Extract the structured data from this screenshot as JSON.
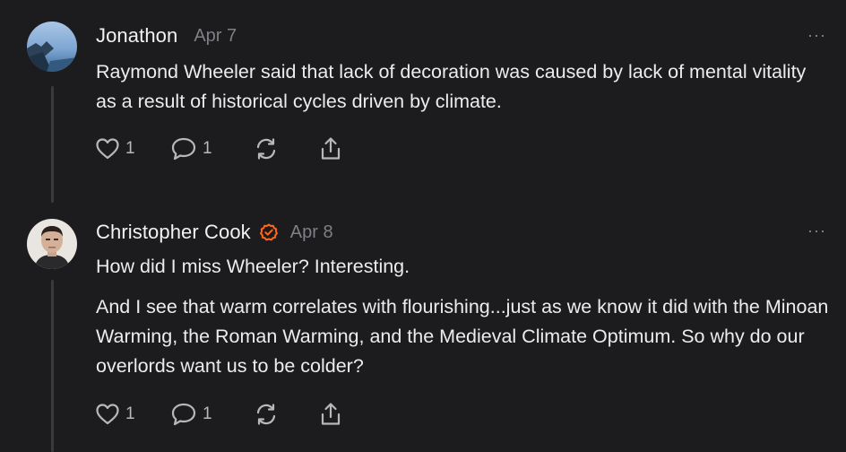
{
  "comments": [
    {
      "author": "Jonathon",
      "date": "Apr 7",
      "verified": false,
      "paragraphs": [
        "Raymond Wheeler said that lack of decoration was caused by lack of mental vitality as a result of historical cycles driven by climate."
      ],
      "likes": "1",
      "replies": "1",
      "more": "···"
    },
    {
      "author": "Christopher Cook",
      "date": "Apr 8",
      "verified": true,
      "paragraphs": [
        "How did I miss Wheeler? Interesting.",
        "And I see that warm correlates with flourishing...just as we know it did with the Minoan Warming, the Roman Warming, and the Medieval Climate Optimum. So why do our overlords want us to be colder?"
      ],
      "likes": "1",
      "replies": "1",
      "more": "···"
    }
  ],
  "colors": {
    "background": "#1c1c1e",
    "verified_badge": "#ff6719",
    "muted_text": "#7f7f84"
  },
  "icons": [
    "heart-icon",
    "comment-icon",
    "restack-icon",
    "share-icon",
    "more-icon",
    "verified-badge-icon"
  ]
}
